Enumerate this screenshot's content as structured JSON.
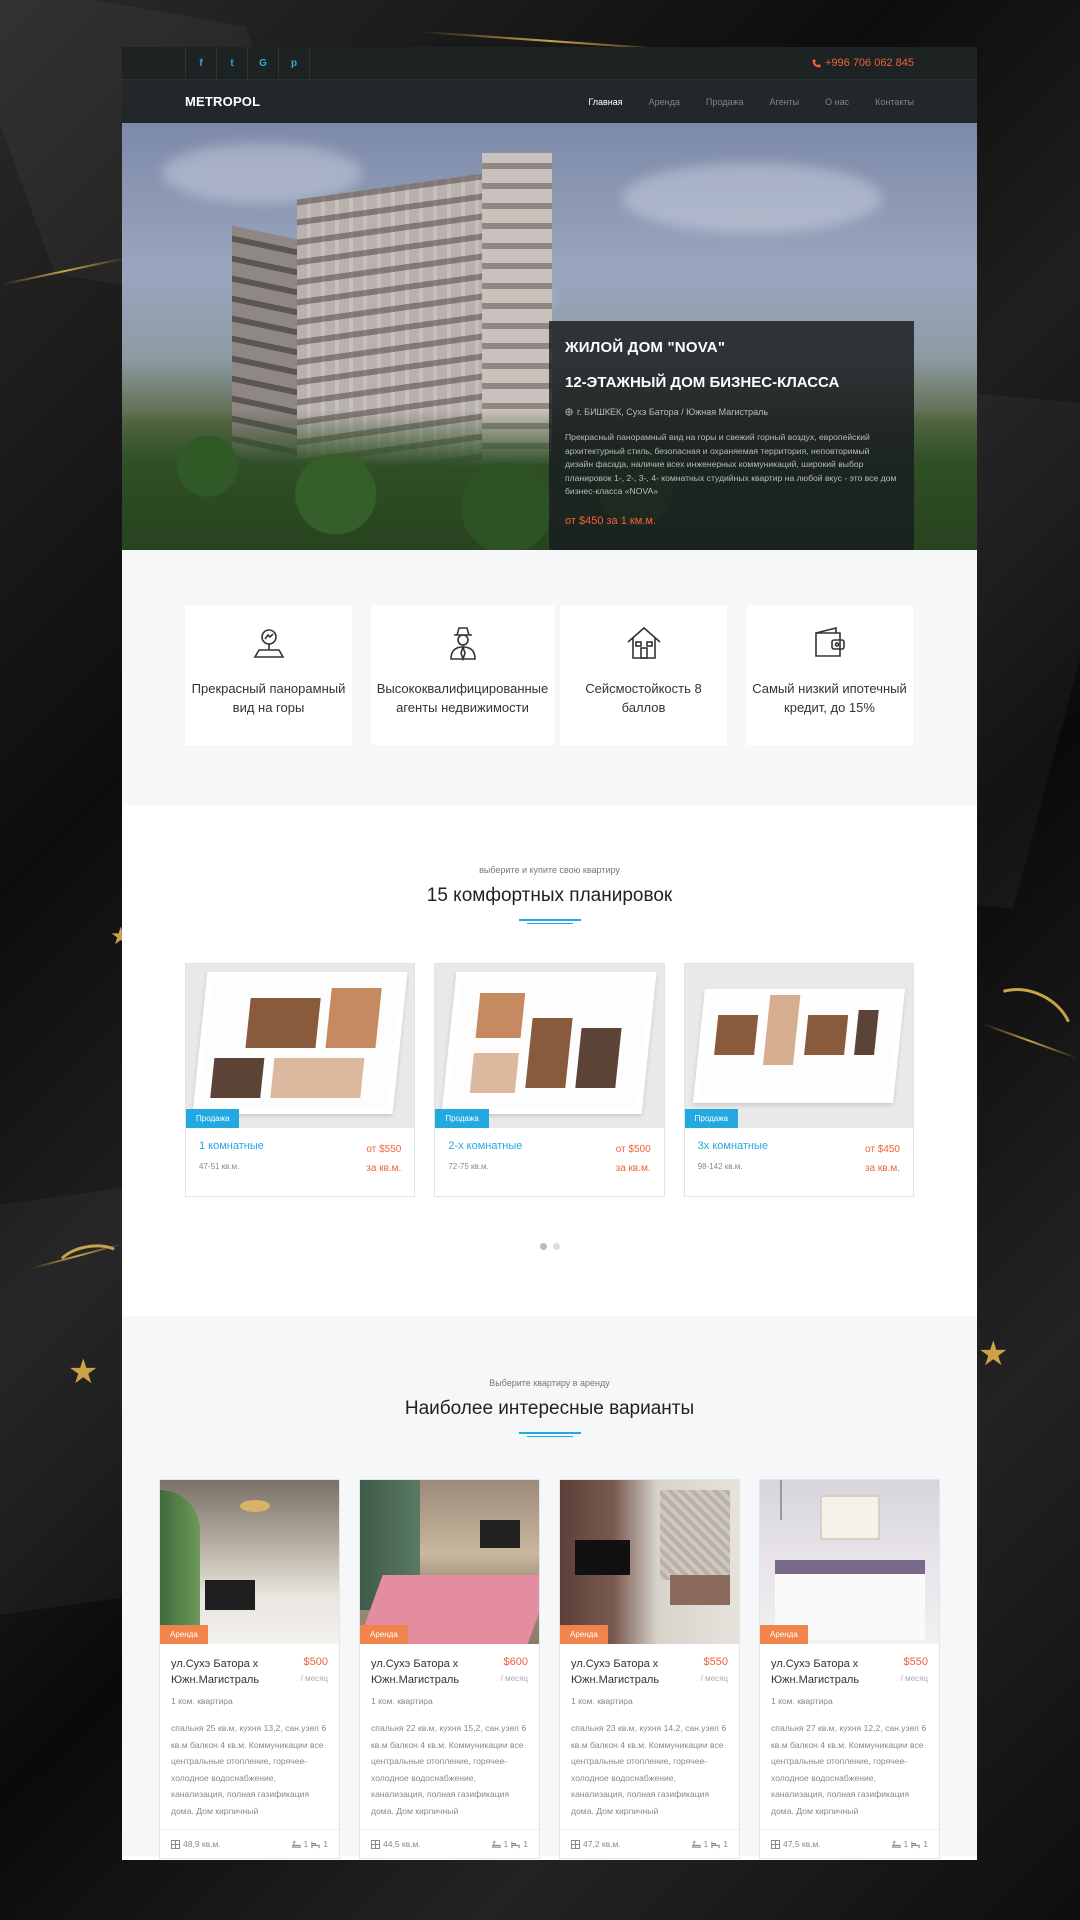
{
  "topbar": {
    "socials": [
      "f",
      "t",
      "G",
      "p"
    ],
    "social_icons": [
      "facebook-icon",
      "twitter-icon",
      "google-icon",
      "pinterest-icon"
    ],
    "phone": "+996 706 062 845"
  },
  "nav": {
    "logo": "METROPOL",
    "items": [
      "Главная",
      "Аренда",
      "Продажа",
      "Агенты",
      "О нас",
      "Контакты"
    ],
    "active_index": 0
  },
  "hero": {
    "title": "ЖИЛОЙ ДОМ \"NOVA\"",
    "subtitle": "12-ЭТАЖНЫЙ ДОМ БИЗНЕС-КЛАССА",
    "location": "г. БИШКЕК, Сухэ Батора / Южная Магистраль",
    "description": "Прекрасный панорамный вид на горы и свежий горный воздух, европейский архитектурный стиль, безопасная и охраняемая территория, неповторимый дизайн фасада, наличие всех инженерных коммуникаций, широкий выбор планировок 1-, 2-, 3-, 4- комнатных студийных квартир на любой вкус - это все дом бизнес-класса «NOVA»",
    "price": "от $450 за 1 км.м."
  },
  "features": [
    {
      "icon": "mountain-view-icon",
      "text": "Прекрасный панорамный вид на горы"
    },
    {
      "icon": "agent-icon",
      "text": "Высококвалифицированные агенты недвижимости"
    },
    {
      "icon": "house-icon",
      "text": "Сейсмостойкость 8 баллов"
    },
    {
      "icon": "wallet-icon",
      "text": "Самый низкий ипотечный кредит, до 15%"
    }
  ],
  "plans": {
    "subtitle": "выберите и купите свою квартиру",
    "title": "15 комфортных планировок",
    "items": [
      {
        "badge": "Продажа",
        "title": "1 комнатные",
        "area": "47-51 кв.м.",
        "price": "от $550",
        "price_unit": "за кв.м."
      },
      {
        "badge": "Продажа",
        "title": "2-х комнатные",
        "area": "72-75 кв.м.",
        "price": "от $500",
        "price_unit": "за кв.м."
      },
      {
        "badge": "Продажа",
        "title": "3х комнатные",
        "area": "98-142 кв.м.",
        "price": "от $450",
        "price_unit": "за кв.м."
      }
    ],
    "slider_pages": 2,
    "slider_active": 0
  },
  "rentals": {
    "subtitle": "Выберите квартиру в аренду",
    "title": "Наиболее интересные варианты",
    "items": [
      {
        "badge": "Аренда",
        "title": "ул.Сухэ Батора х Южн.Магистраль",
        "price": "$500",
        "per": "/ месяц",
        "type": "1 ком. квартира",
        "desc": "спальня 25 кв.м, кухня 13,2, сан.узел 6 кв.м балкон 4 кв.м. Коммуникации все центральные отопление, горячее-холодное водоснабжение, канализация, полная газификация дома. Дом кирпичный",
        "area": "48,9 кв.м.",
        "baths": "1",
        "beds": "1"
      },
      {
        "badge": "Аренда",
        "title": "ул.Сухэ Батора х Южн.Магистраль",
        "price": "$600",
        "per": "/ месяц",
        "type": "1 ком. квартира",
        "desc": "спальня 22 кв.м, кухня 15,2, сан.узел 6 кв.м балкон 4 кв.м. Коммуникации все центральные отопление, горячее-холодное водоснабжение, канализация, полная газификация дома. Дом кирпичный",
        "area": "44,5 кв.м.",
        "baths": "1",
        "beds": "1"
      },
      {
        "badge": "Аренда",
        "title": "ул.Сухэ Батора х Южн.Магистраль",
        "price": "$550",
        "per": "/ месяц",
        "type": "1 ком. квартира",
        "desc": "спальня 23 кв.м, кухня 14,2, сан.узел 6 кв.м балкон 4 кв.м. Коммуникации все центральные отопление, горячее-холодное водоснабжение, канализация, полная газификация дома. Дом кирпичный",
        "area": "47,2 кв.м.",
        "baths": "1",
        "beds": "1"
      },
      {
        "badge": "Аренда",
        "title": "ул.Сухэ Батора х Южн.Магистраль",
        "price": "$550",
        "per": "/ месяц",
        "type": "1 ком. квартира",
        "desc": "спальня 27 кв.м, кухня 12,2, сан.узел 6 кв.м балкон 4 кв.м. Коммуникации все центральные отопление, горячее-холодное водоснабжение, канализация, полная газификация дома. Дом кирпичный",
        "area": "47,5 кв.м.",
        "baths": "1",
        "beds": "1"
      }
    ]
  },
  "colors": {
    "accent_blue": "#23a9e1",
    "accent_orange": "#f0623a",
    "rent_badge": "#f0844a",
    "dark_bar": "#1d2223"
  }
}
